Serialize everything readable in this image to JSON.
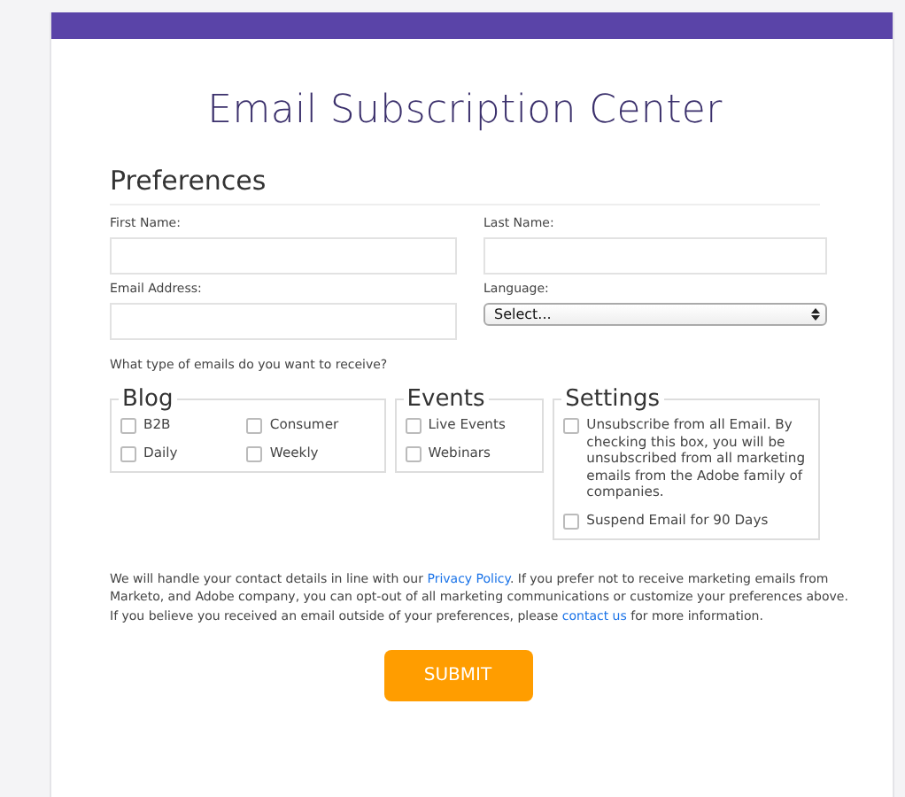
{
  "title": "Email Subscription Center",
  "section": "Preferences",
  "fields": [
    {
      "label": "First Name:",
      "kind": "text"
    },
    {
      "label": "Last Name:",
      "kind": "text"
    },
    {
      "label": "Email Address:",
      "kind": "text"
    },
    {
      "label": "Language:",
      "kind": "select",
      "value": "Select..."
    }
  ],
  "question": "What type of emails do you want to receive?",
  "groups": [
    {
      "legend": "Blog",
      "kind": "grid",
      "options": [
        {
          "label": "B2B",
          "checked": false
        },
        {
          "label": "Consumer",
          "checked": false
        },
        {
          "label": "Daily",
          "checked": false
        },
        {
          "label": "Weekly",
          "checked": false
        }
      ]
    },
    {
      "legend": "Events",
      "kind": "list",
      "options": [
        {
          "label": "Live Events",
          "checked": false
        },
        {
          "label": "Webinars",
          "checked": false
        }
      ]
    },
    {
      "legend": "Settings",
      "kind": "list",
      "options": [
        {
          "label": "Unsubscribe from all Email. By checking this box, you will be unsubscribed from all marketing emails from the Adobe family of companies.",
          "checked": false
        },
        {
          "label": "Suspend Email for 90 Days",
          "checked": false
        }
      ]
    }
  ],
  "notice": [
    {
      "kind": "text",
      "text": "We will handle your contact details in line with our "
    },
    {
      "kind": "link",
      "text": "Privacy Policy"
    },
    {
      "kind": "text",
      "text": ". If you prefer not to receive marketing emails from Marketo, and Adobe company, you can opt-out of all marketing communications or customize your preferences above. If you believe you received an email outside of your preferences, please "
    },
    {
      "kind": "link",
      "text": "contact us"
    },
    {
      "kind": "text",
      "text": " for more information."
    }
  ],
  "submit": "SUBMIT"
}
